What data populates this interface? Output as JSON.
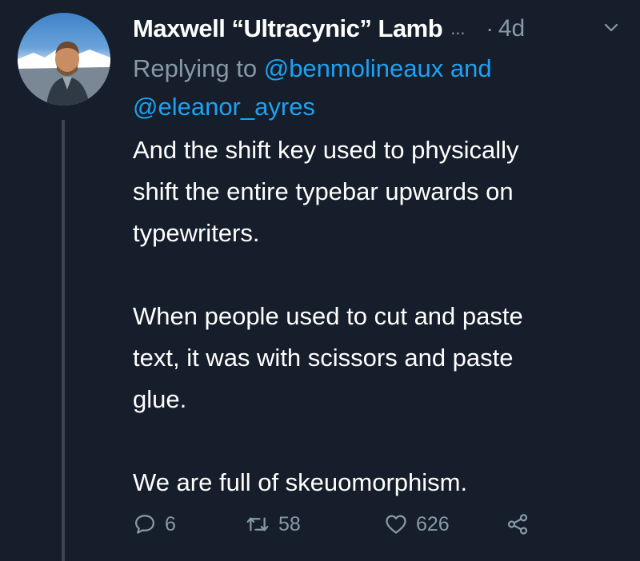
{
  "tweet": {
    "author": "Maxwell “Ultracynic” Lamb",
    "truncation": "...",
    "separator": "·",
    "time": "4d",
    "reply_prefix": "Replying to",
    "mentions": [
      "@benmolineaux",
      "@eleanor_ayres"
    ],
    "reply_joiner": "and",
    "paragraphs": [
      [
        "And the shift key used to physically",
        "shift the entire typebar upwards on",
        "typewriters."
      ],
      [
        "When people used to cut and paste",
        "text, it was with scissors and paste",
        "glue."
      ],
      [
        "We are full of skeuomorphism."
      ]
    ]
  },
  "actions": {
    "reply_count": "6",
    "retweet_count": "58",
    "like_count": "626"
  },
  "icons": {
    "avatar": "profile-photo",
    "chevron": "chevron-down-icon",
    "reply": "reply-bubble-icon",
    "retweet": "retweet-icon",
    "like": "heart-icon",
    "share": "share-icon"
  },
  "colors": {
    "background": "#151e2a",
    "text": "#ffffff",
    "muted": "#8899a6",
    "link": "#1da1f2",
    "thread_line": "#3b4654"
  }
}
